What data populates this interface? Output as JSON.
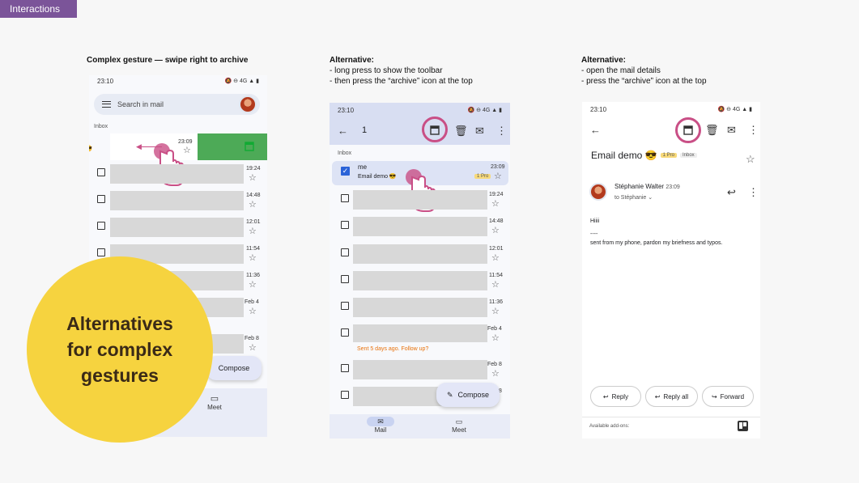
{
  "tag": "Interactions",
  "col1": {
    "caption": "Complex gesture — swipe right to archive"
  },
  "col2": {
    "caption": "Alternative:",
    "line1": "- long press to show the toolbar",
    "line2": "- then press the “archive” icon at the top"
  },
  "col3": {
    "caption": "Alternative:",
    "line1": "- open the mail details",
    "line2": "- press the “archive” icon at the top"
  },
  "phone1": {
    "time": "23:10",
    "status": "4G",
    "search_placeholder": "Search in mail",
    "inbox": "Inbox",
    "swipe_time": "23:09",
    "times": [
      "19:24",
      "14:48",
      "12:01",
      "11:54",
      "11:36",
      "Feb 4",
      "Feb 8"
    ],
    "compose": "Compose",
    "meet": "Meet"
  },
  "phone2": {
    "time": "23:10",
    "status": "4G",
    "count": "1",
    "inbox": "Inbox",
    "sender": "me",
    "subject": "Email demo 😎",
    "sel_time": "23:09",
    "badge": "1 Pro",
    "times": [
      "19:24",
      "14:48",
      "12:01",
      "11:54",
      "11:36",
      "Feb 4",
      "Feb 8",
      "Feb 8"
    ],
    "followup": "Sent 5 days ago. Follow up?",
    "compose": "Compose",
    "mail": "Mail",
    "meet": "Meet"
  },
  "phone3": {
    "time": "23:10",
    "status": "4G",
    "subject": "Email demo 😎",
    "badge": "1 Pro",
    "inbox_badge": "Inbox",
    "sender": "Stéphanie Walter",
    "sent_time": "23:09",
    "to": "to Stéphanie",
    "greeting": "Hiiii",
    "sig_sep": "----",
    "signature": "sent from my phone, pardon my briefness and typos.",
    "reply": "Reply",
    "reply_all": "Reply all",
    "forward": "Forward",
    "addons": "Available add-ons:"
  },
  "bubble": {
    "line1": "Alternatives",
    "line2": "for complex",
    "line3": "gestures"
  },
  "colors": {
    "accent": "#c94f86",
    "archive_green": "#4daa57",
    "bubble": "#f6d33f",
    "tag": "#7b5499"
  },
  "icons": [
    "search-icon",
    "archive-icon",
    "trash-icon",
    "mail-icon",
    "more-icon",
    "back-icon",
    "star-icon",
    "reply-icon",
    "forward-icon",
    "pencil-icon",
    "video-icon",
    "hand-pointer-icon"
  ]
}
